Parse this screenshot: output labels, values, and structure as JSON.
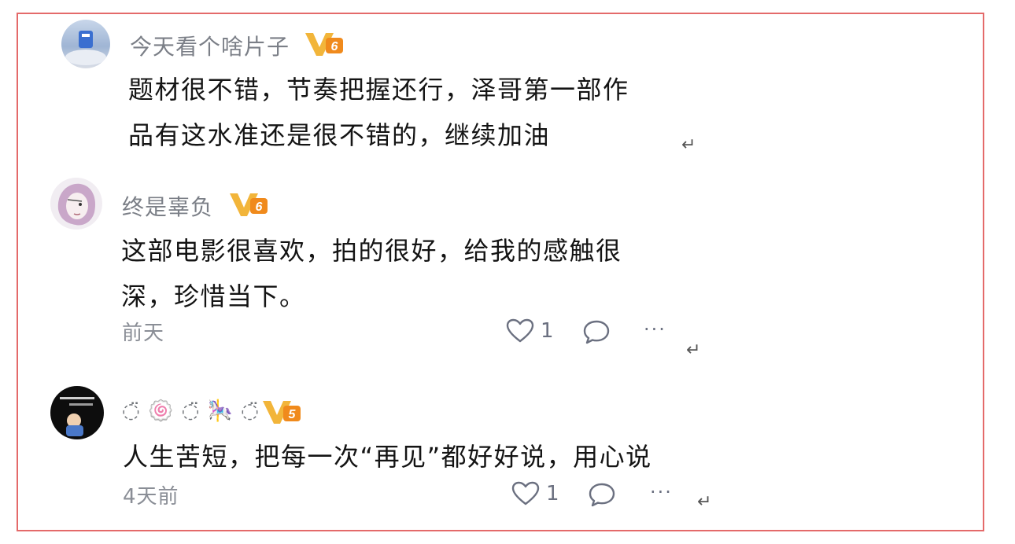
{
  "comments": [
    {
      "username": "今天看个啥片子",
      "level": "6",
      "content": "题材很不错，节奏把握还行，泽哥第一部作\n品有这水准还是很不错的，继续加油",
      "return_mark": "↵"
    },
    {
      "username": "终是辜负",
      "level": "6",
      "content": "这部电影很喜欢，拍的很好，给我的感触很\n深，珍惜当下。",
      "time": "前天",
      "likes": "1",
      "more": "···",
      "return_mark": "↵"
    },
    {
      "username": "◌̈ 🍥 ◌̈ 🎠 ◌̈",
      "level": "5",
      "content": "人生苦短，把每一次“再见”都好好说，用心说",
      "time": "4天前",
      "likes": "1",
      "more": "···",
      "return_mark": "↵"
    }
  ],
  "colors": {
    "frame_border": "#e46a6a",
    "badge_gold": "#f2b53a",
    "badge_orange": "#f08a1c",
    "name_gray": "#7b7f87",
    "action_gray": "#6b7080"
  }
}
